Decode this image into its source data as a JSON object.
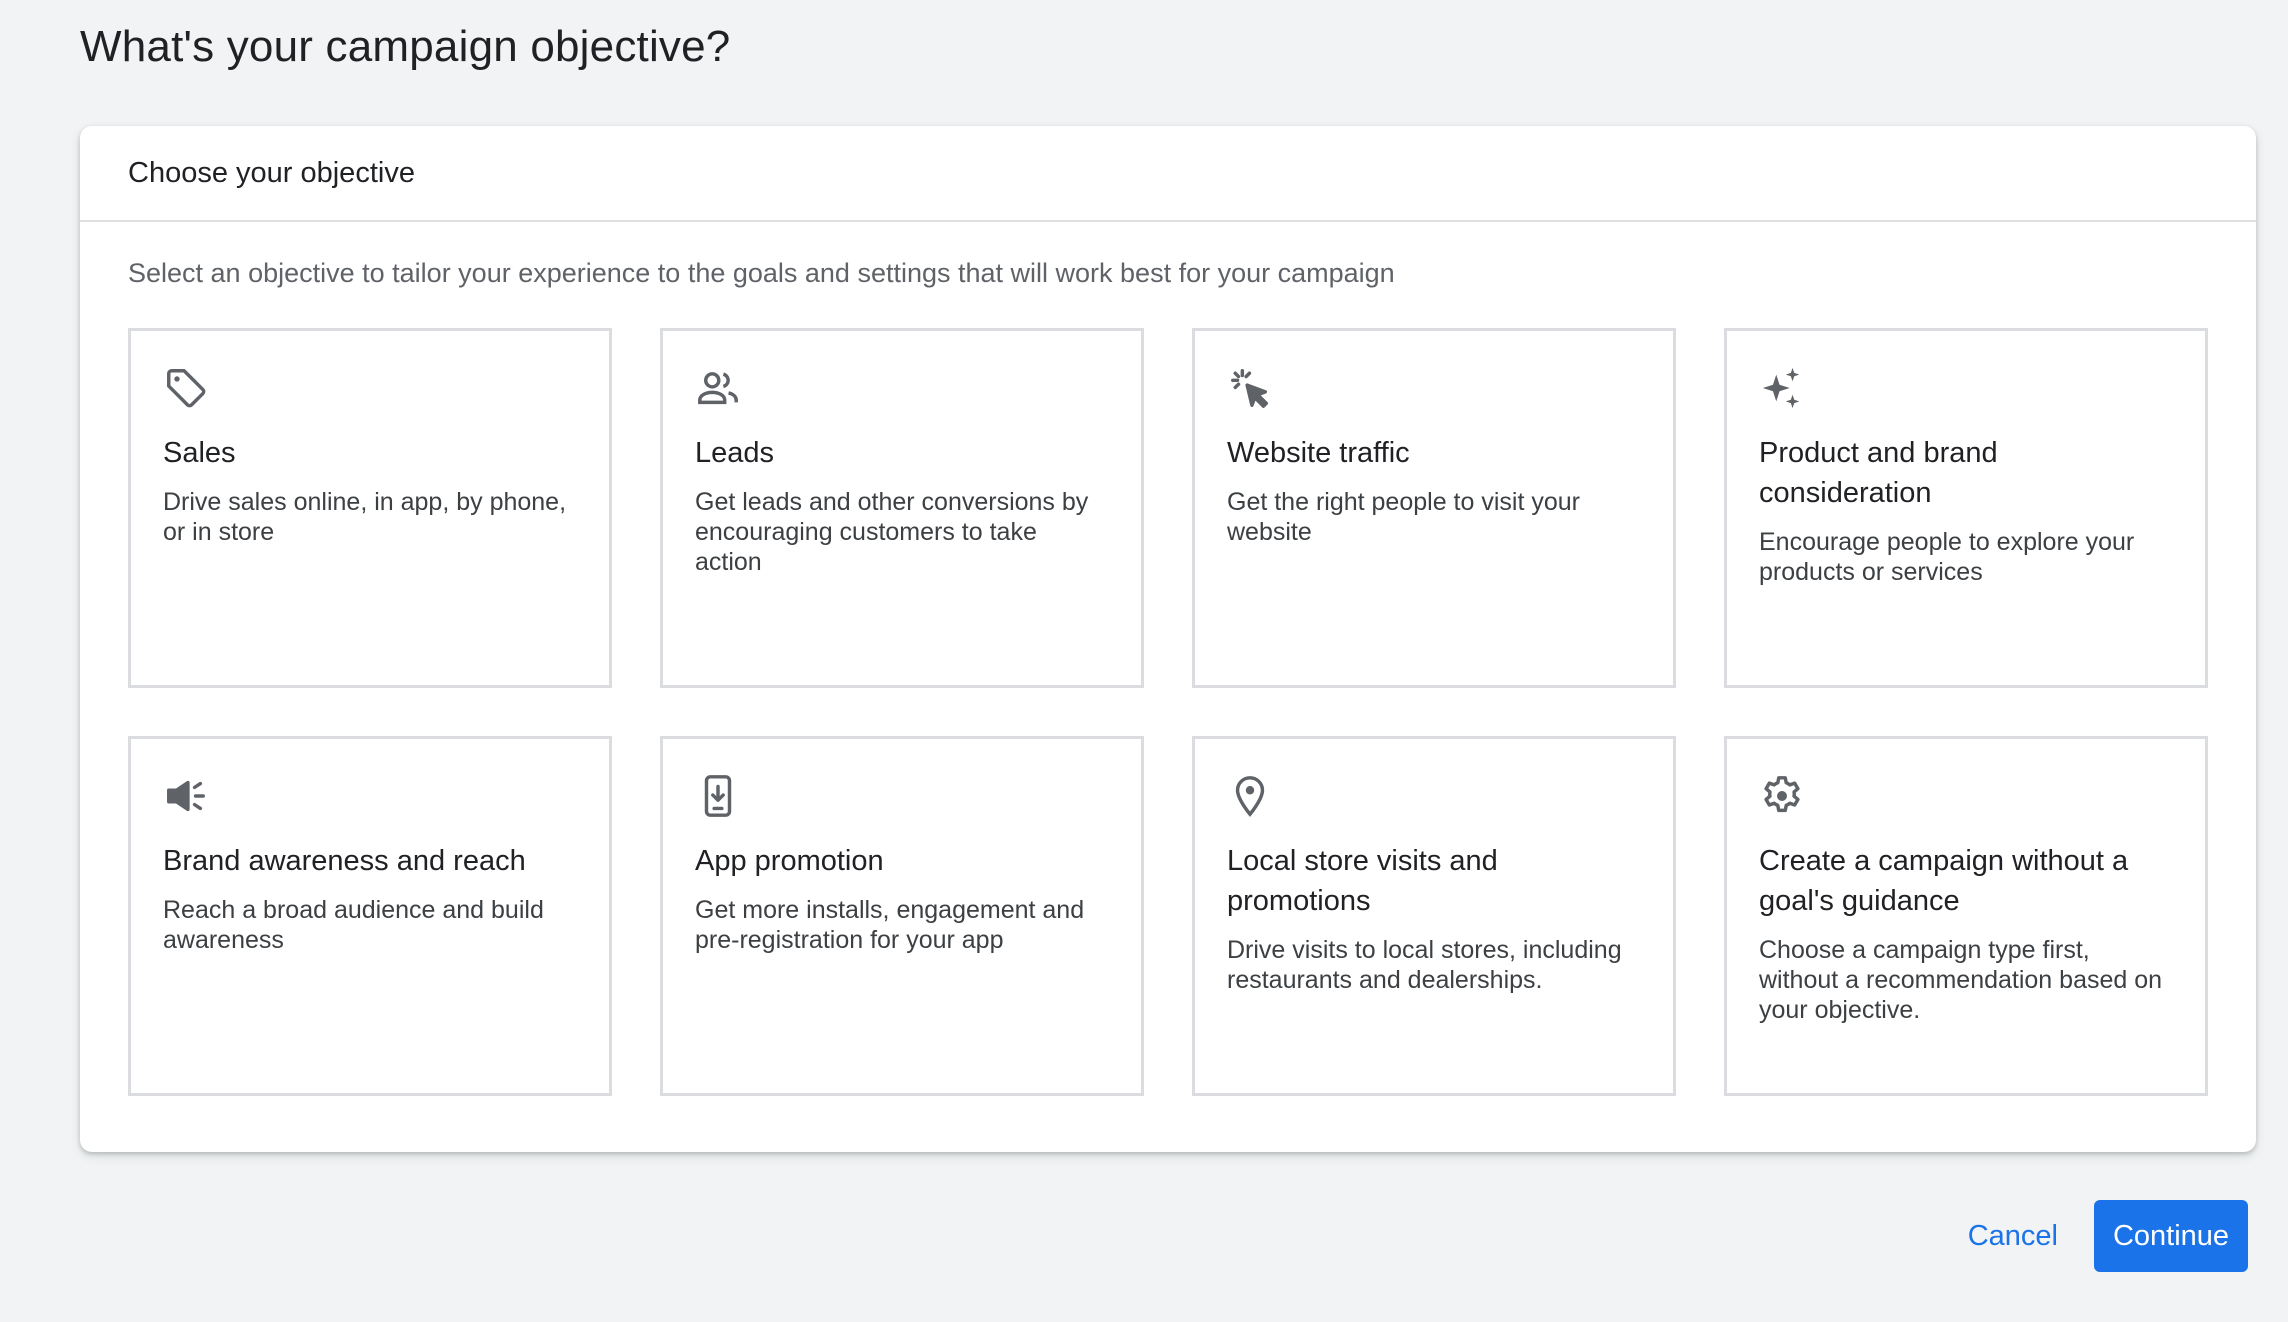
{
  "page": {
    "title": "What's your campaign objective?"
  },
  "card": {
    "header_title": "Choose your objective",
    "subtitle": "Select an objective to tailor your experience to the goals and settings that will work best for your campaign"
  },
  "objectives": [
    {
      "icon": "tag-icon",
      "title": "Sales",
      "description": "Drive sales online, in app, by phone, or in store"
    },
    {
      "icon": "people-icon",
      "title": "Leads",
      "description": "Get leads and other conversions by encouraging customers to take action"
    },
    {
      "icon": "cursor-click-icon",
      "title": "Website traffic",
      "description": "Get the right people to visit your website"
    },
    {
      "icon": "sparkle-icon",
      "title": "Product and brand consideration",
      "description": "Encourage people to explore your products or services"
    },
    {
      "icon": "megaphone-icon",
      "title": "Brand awareness and reach",
      "description": "Reach a broad audience and build awareness"
    },
    {
      "icon": "phone-download-icon",
      "title": "App promotion",
      "description": "Get more installs, engagement and pre-registration for your app"
    },
    {
      "icon": "location-pin-icon",
      "title": "Local store visits and promotions",
      "description": "Drive visits to local stores, including restaurants and dealerships."
    },
    {
      "icon": "gear-icon",
      "title": "Create a campaign without a goal's guidance",
      "description": "Choose a campaign type first, without a recommendation based on your objective."
    }
  ],
  "footer": {
    "cancel_label": "Cancel",
    "continue_label": "Continue"
  },
  "colors": {
    "accent": "#1a73e8",
    "background": "#f1f3f4",
    "tile_border": "#dadce0",
    "icon": "#5f6368"
  }
}
